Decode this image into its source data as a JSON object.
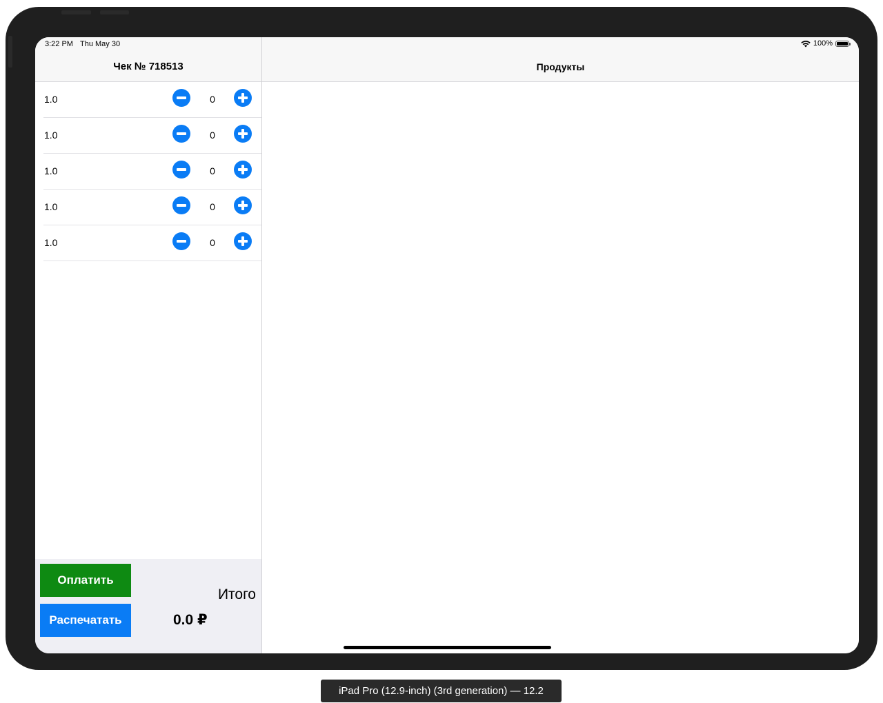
{
  "status_bar": {
    "time": "3:22 PM",
    "date": "Thu May 30",
    "battery": "100%",
    "icons": [
      "wifi-icon",
      "battery-icon"
    ]
  },
  "receipt": {
    "title": "Чек № 718513",
    "items": [
      {
        "price": "1.0",
        "quantity": "0"
      },
      {
        "price": "1.0",
        "quantity": "0"
      },
      {
        "price": "1.0",
        "quantity": "0"
      },
      {
        "price": "1.0",
        "quantity": "0"
      },
      {
        "price": "1.0",
        "quantity": "0"
      }
    ],
    "pay_label": "Оплатить",
    "print_label": "Распечатать",
    "total_label": "Итого",
    "total_value": "0.0 ₽"
  },
  "products": {
    "title": "Продукты"
  },
  "device_caption": "iPad Pro (12.9-inch) (3rd generation) — 12.2",
  "colors": {
    "accent": "#0a7cf5",
    "pay_button": "#0e8a12",
    "footer_background": "#efeff4",
    "nav_background": "#f7f7f7",
    "device_frame": "#1f1f1f"
  }
}
